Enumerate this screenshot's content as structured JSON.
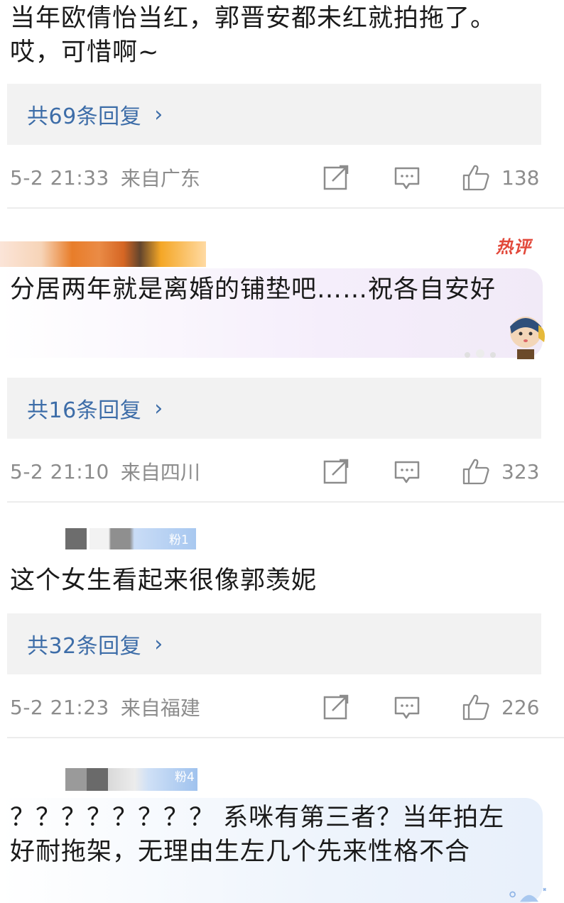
{
  "comments": [
    {
      "text": "当年欧倩怡当红，郭晋安都未红就拍拖了。哎，可惜啊~",
      "reply_link": "共69条回复",
      "time": "5-2 21:33",
      "location": "来自广东",
      "likes": "138"
    },
    {
      "hot_badge": "热评",
      "text": "分居两年就是离婚的铺垫吧……祝各自安好",
      "reply_link": "共16条回复",
      "time": "5-2 21:10",
      "location": "来自四川",
      "likes": "323"
    },
    {
      "fan_badge": "粉1",
      "text": "这个女生看起来很像郭羡妮",
      "reply_link": "共32条回复",
      "time": "5-2 21:23",
      "location": "来自福建",
      "likes": "226"
    },
    {
      "fan_badge": "粉4",
      "text": "？？？？？？？？ 系咪有第三者？当年拍左好耐拖架，无理由生左几个先来性格不合"
    }
  ],
  "icons": {
    "share": "share-edit-icon",
    "comment": "comment-icon",
    "like": "thumbs-up-icon",
    "chevron": "chevron-right-icon"
  },
  "colors": {
    "link": "#3d6da8",
    "meta": "#8c8c8c",
    "reply_bg": "#f2f2f2",
    "hot": "#e2483a"
  }
}
